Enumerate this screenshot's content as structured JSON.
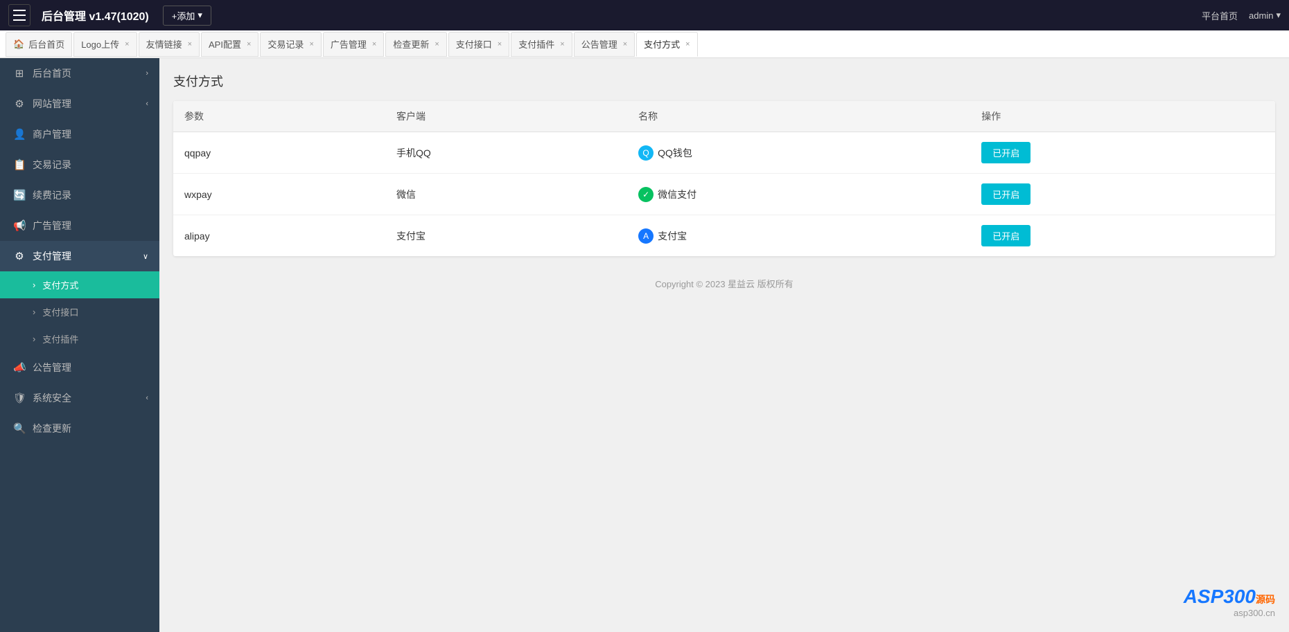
{
  "header": {
    "logo": "后台管理 v1.47(1020)",
    "add_label": "+添加",
    "platform_home": "平台首页",
    "admin": "admin"
  },
  "tabs": [
    {
      "id": "home",
      "label": "后台首页",
      "closable": false,
      "active": false,
      "icon": "🏠"
    },
    {
      "id": "logo",
      "label": "Logo上传",
      "closable": true,
      "active": false
    },
    {
      "id": "links",
      "label": "友情链接",
      "closable": true,
      "active": false
    },
    {
      "id": "api",
      "label": "API配置",
      "closable": true,
      "active": false
    },
    {
      "id": "trade",
      "label": "交易记录",
      "closable": true,
      "active": false
    },
    {
      "id": "ads",
      "label": "广告管理",
      "closable": true,
      "active": false
    },
    {
      "id": "check",
      "label": "检查更新",
      "closable": true,
      "active": false
    },
    {
      "id": "payif",
      "label": "支付接口",
      "closable": true,
      "active": false
    },
    {
      "id": "payplug",
      "label": "支付插件",
      "closable": true,
      "active": false
    },
    {
      "id": "notice",
      "label": "公告管理",
      "closable": true,
      "active": false
    },
    {
      "id": "paymethod",
      "label": "支付方式",
      "closable": true,
      "active": true
    }
  ],
  "sidebar": {
    "items": [
      {
        "id": "dashboard",
        "label": "后台首页",
        "icon": "⊞",
        "expandable": false,
        "active": false
      },
      {
        "id": "website",
        "label": "网站管理",
        "icon": "⚙",
        "expandable": true,
        "active": false
      },
      {
        "id": "merchant",
        "label": "商户管理",
        "icon": "👤",
        "expandable": false,
        "active": false
      },
      {
        "id": "trade",
        "label": "交易记录",
        "icon": "📋",
        "expandable": false,
        "active": false
      },
      {
        "id": "renew",
        "label": "续费记录",
        "icon": "🔄",
        "expandable": false,
        "active": false
      },
      {
        "id": "ads",
        "label": "广告管理",
        "icon": "📢",
        "expandable": false,
        "active": false
      },
      {
        "id": "payment",
        "label": "支付管理",
        "icon": "⚙",
        "expandable": true,
        "active": true,
        "expanded": true
      },
      {
        "id": "paymethod-sub",
        "label": "支付方式",
        "icon": "›",
        "sub": true,
        "active": true
      },
      {
        "id": "payif-sub",
        "label": "支付接口",
        "icon": "›",
        "sub": true,
        "active": false
      },
      {
        "id": "payplug-sub",
        "label": "支付插件",
        "icon": "›",
        "sub": true,
        "active": false
      },
      {
        "id": "notice",
        "label": "公告管理",
        "icon": "📣",
        "expandable": false,
        "active": false
      },
      {
        "id": "security",
        "label": "系统安全",
        "icon": "🛡",
        "expandable": true,
        "active": false
      },
      {
        "id": "checkupdate",
        "label": "检查更新",
        "icon": "🔍",
        "expandable": false,
        "active": false
      }
    ]
  },
  "page": {
    "title": "支付方式",
    "table": {
      "columns": [
        "参数",
        "客户端",
        "名称",
        "操作"
      ],
      "rows": [
        {
          "param": "qqpay",
          "client": "手机QQ",
          "name": "QQ钱包",
          "icon_type": "qq",
          "icon_char": "Q",
          "status": "已开启"
        },
        {
          "param": "wxpay",
          "client": "微信",
          "name": "微信支付",
          "icon_type": "wechat",
          "icon_char": "✓",
          "status": "已开启"
        },
        {
          "param": "alipay",
          "client": "支付宝",
          "name": "支付宝",
          "icon_type": "alipay",
          "icon_char": "A",
          "status": "已开启"
        }
      ]
    }
  },
  "footer": {
    "copyright": "Copyright © 2023 星益云 版权所有"
  },
  "watermark": {
    "line1": "ASP300源码",
    "line2": "asp300.cn"
  }
}
